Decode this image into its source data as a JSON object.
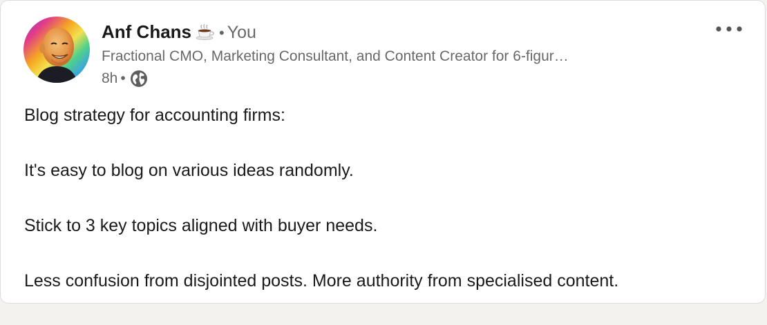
{
  "post": {
    "author": {
      "name": "Anf Chans",
      "name_emoji": "☕",
      "separator": "•",
      "relation": "You",
      "headline": "Fractional CMO, Marketing Consultant, and Content Creator for 6-figur…",
      "time": "8h",
      "time_separator": "•",
      "visibility_icon": "globe-icon",
      "avatar_icon": "profile-photo"
    },
    "menu_icon": "more-horizontal-icon",
    "paragraphs": [
      "Blog strategy for accounting firms:",
      "It's easy to blog on various ideas randomly.",
      "Stick to 3 key topics aligned with buyer needs.",
      "Less confusion from disjointed posts. More authority from specialised content."
    ]
  },
  "colors": {
    "text_primary": "#191919",
    "text_secondary": "#666666",
    "card_background": "#ffffff",
    "card_border": "#dcdcdc"
  }
}
